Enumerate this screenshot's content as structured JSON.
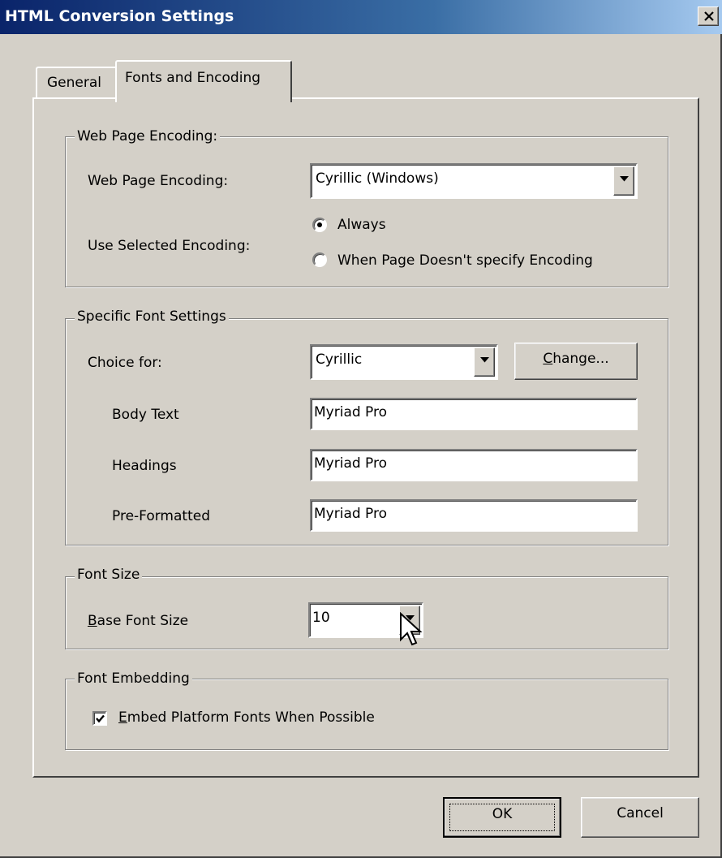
{
  "window": {
    "title": "HTML Conversion Settings",
    "close_icon": "close-icon"
  },
  "tabs": [
    {
      "label": "General",
      "selected": false
    },
    {
      "label": "Fonts and Encoding",
      "selected": true
    }
  ],
  "encoding_group": {
    "legend": "Web Page Encoding:",
    "encoding_label": "Web Page Encoding:",
    "encoding_value": "Cyrillic (Windows)",
    "use_label": "Use Selected Encoding:",
    "radio_always": "Always",
    "radio_when": "When Page Doesn't specify Encoding",
    "selected_option": "Always"
  },
  "font_group": {
    "legend": "Specific Font Settings",
    "choice_label": "Choice for:",
    "choice_value": "Cyrillic",
    "change_button_prefix": "",
    "change_button_mnemonic": "C",
    "change_button_rest": "hange...",
    "body_label": "Body Text",
    "body_value": "Myriad Pro",
    "headings_label": "Headings",
    "headings_value": "Myriad Pro",
    "pre_label": "Pre-Formatted",
    "pre_value": "Myriad Pro"
  },
  "size_group": {
    "legend": "Font Size",
    "base_label_mnemonic": "B",
    "base_label_rest": "ase Font Size",
    "base_value": "10"
  },
  "embed_group": {
    "legend": "Font Embedding",
    "checkbox_mnemonic": "E",
    "checkbox_rest": "mbed Platform Fonts When Possible",
    "checked": true
  },
  "footer": {
    "ok_label": "OK",
    "cancel_label": "Cancel"
  },
  "colors": {
    "face": "#d4d0c8",
    "title_start": "#0a246a",
    "title_end": "#a6caf0"
  }
}
